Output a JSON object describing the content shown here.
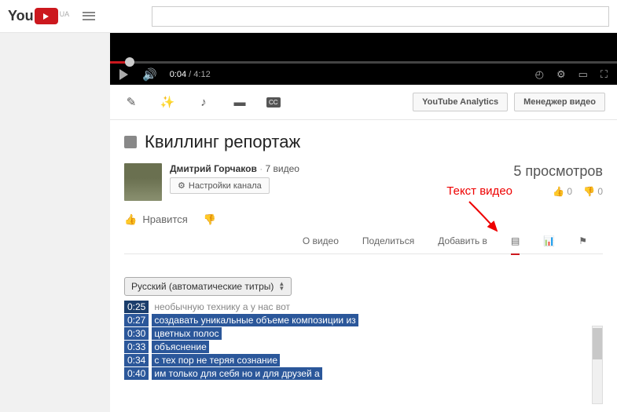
{
  "header": {
    "logo_text": "Tube",
    "country": "UA",
    "search_placeholder": ""
  },
  "player": {
    "current_time": "0:04",
    "duration": "4:12"
  },
  "toolbar": {
    "analytics_btn": "YouTube Analytics",
    "manager_btn": "Менеджер видео"
  },
  "video": {
    "title": "Квиллинг репортаж",
    "author": "Дмитрий Горчаков",
    "video_count": "7 видео",
    "settings_label": "Настройки канала",
    "views": "5 просмотров",
    "likes": "0",
    "dislikes": "0",
    "like_label": "Нравится"
  },
  "tabs": {
    "about": "О видео",
    "share": "Поделиться",
    "addto": "Добавить в"
  },
  "annotation": {
    "label": "Текст видео"
  },
  "transcript": {
    "language": "Русский (автоматические титры)",
    "rows": [
      {
        "t": "0:25",
        "x": "необычную технику а у нас вот"
      },
      {
        "t": "0:27",
        "x": "создавать уникальные объеме композиции из"
      },
      {
        "t": "0:30",
        "x": "цветных полос"
      },
      {
        "t": "0:33",
        "x": "объяснение"
      },
      {
        "t": "0:34",
        "x": "с тех пор не теряя сознание"
      },
      {
        "t": "0:40",
        "x": "им только для себя но и для друзей а"
      }
    ]
  }
}
